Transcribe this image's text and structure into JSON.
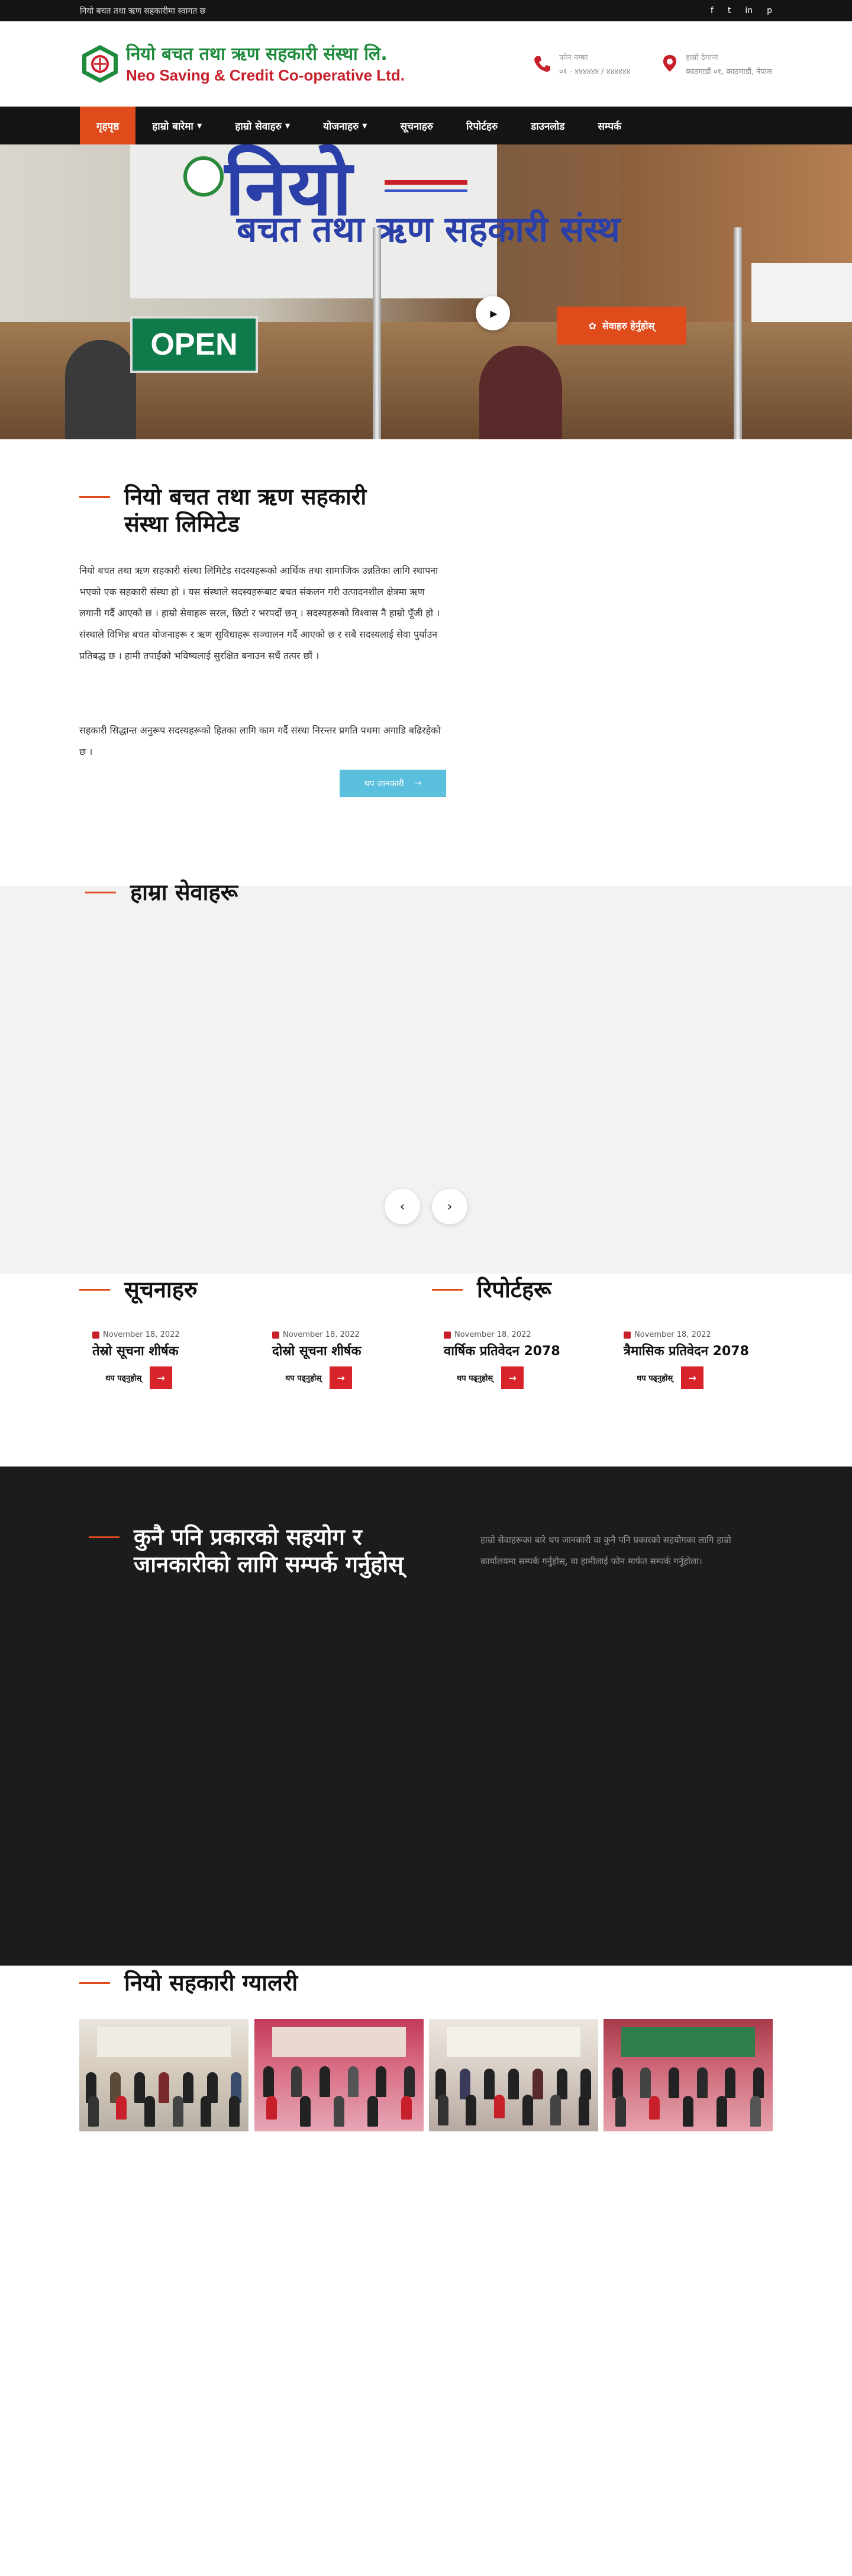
{
  "topbar": {
    "tagline": "नियो बचत तथा ऋण सहकारीमा स्वागत छ",
    "social": [
      "f",
      "t",
      "in",
      "p"
    ]
  },
  "header": {
    "logo_np": "नियो बचत तथा ऋण सहकारी संस्था लि.",
    "logo_en": "Neo Saving & Credit Co-operative Ltd.",
    "phone_label": "फोन नम्बर",
    "phone_value": "०१ - ४४४४४४ / ४४४४४४",
    "address_label": "हाम्रो ठेगाना",
    "address_value": "काठमाडौं ०१, काठमाडौं, नेपाल"
  },
  "nav": {
    "items": [
      {
        "label": "गृहपृष्ठ",
        "dropdown": false
      },
      {
        "label": "हाम्रो बारेमा",
        "dropdown": true
      },
      {
        "label": "हाम्रो सेवाहरु",
        "dropdown": true
      },
      {
        "label": "योजनाहरु",
        "dropdown": true
      },
      {
        "label": "सूचनाहरु",
        "dropdown": false
      },
      {
        "label": "रिपोर्टहरु",
        "dropdown": false
      },
      {
        "label": "डाउनलोड",
        "dropdown": false
      },
      {
        "label": "सम्पर्क",
        "dropdown": false
      }
    ]
  },
  "hero": {
    "sign_big": "नियो",
    "sign_small": "बचत तथा ऋण सहकारी संस्था लि.",
    "open_sign": "OPEN",
    "cta_label": "सेवाहरु हेर्नुहोस्"
  },
  "about": {
    "title": "नियो बचत तथा ऋण सहकारी संस्था लिमिटेड",
    "paragraph1": "नियो बचत तथा ऋण सहकारी संस्था लिमिटेड सदस्यहरूको आर्थिक तथा सामाजिक उन्नतिका लागि स्थापना भएको एक सहकारी संस्था हो । यस संस्थाले सदस्यहरूबाट बचत संकलन गरी उत्पादनशील क्षेत्रमा ऋण लगानी गर्दै आएको छ । हाम्रो सेवाहरू सरल, छिटो र भरपर्दो छन् । सदस्यहरूको विश्वास नै हाम्रो पूँजी हो । संस्थाले विभिन्न बचत योजनाहरू र ऋण सुविधाहरू सञ्चालन गर्दै आएको छ र सबै सदस्यलाई सेवा पुर्याउन प्रतिबद्ध छ । हामी तपाईंको भविष्यलाई सुरक्षित बनाउन सधैं तत्पर छौं ।",
    "paragraph2": "सहकारी सिद्धान्त अनुरूप सदस्यहरूको हितका लागि काम गर्दै संस्था निरन्तर प्रगति पथमा अगाडि बढिरहेको छ ।",
    "more_label": "थप जानकारी"
  },
  "services": {
    "title": "हाम्रा सेवाहरू",
    "prev": "‹",
    "next": "›"
  },
  "notices": {
    "title": "सूचनाहरु",
    "items": [
      {
        "date": "November 18, 2022",
        "title": "तेस्रो सूचना शीर्षक",
        "more": "थप पढ्नुहोस्"
      },
      {
        "date": "November 18, 2022",
        "title": "दोस्रो सूचना शीर्षक",
        "more": "थप पढ्नुहोस्"
      }
    ]
  },
  "reports": {
    "title": "रिपोर्टहरू",
    "items": [
      {
        "date": "November 18, 2022",
        "title": "वार्षिक प्रतिवेदन 2078",
        "more": "थप पढ्नुहोस्"
      },
      {
        "date": "November 18, 2022",
        "title": "त्रैमासिक प्रतिवेदन 2078",
        "more": "थप पढ्नुहोस्"
      }
    ]
  },
  "contact_section": {
    "title": "कुनै पनि प्रकारको सहयोग र जानकारीको लागि सम्पर्क गर्नुहोस्",
    "text": "हाम्रो सेवाहरूका बारे थप जानकारी वा कुनै पनि प्रकारको सहयोगका लागि हाम्रो कार्यालयमा सम्पर्क गर्नुहोस्, वा हामीलाई फोन मार्फत सम्पर्क गर्नुहोला।"
  },
  "gallery": {
    "title": "नियो सहकारी ग्यालरी"
  },
  "colors": {
    "accent": "#e04b1c",
    "dark": "#141414",
    "brand_green": "#1e8a3c",
    "brand_red": "#c8202a"
  }
}
